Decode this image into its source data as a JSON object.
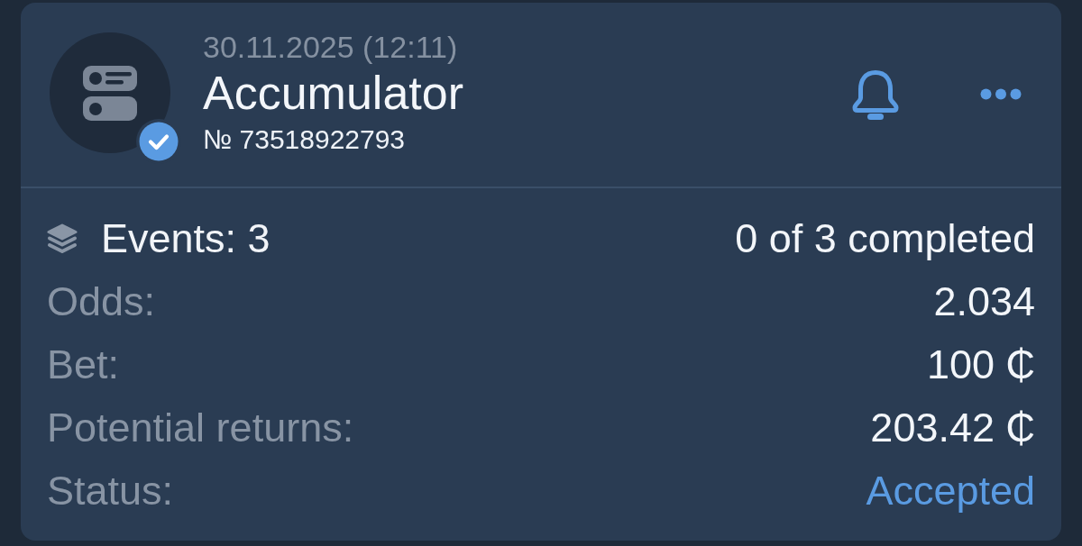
{
  "bet": {
    "date": "30.11.2025 (12:11)",
    "title": "Accumulator",
    "number": "№ 73518922793",
    "verified": true
  },
  "events": {
    "label": "Events: 3",
    "completed": "0 of 3 completed"
  },
  "details": [
    {
      "label": "Odds:",
      "value": "2.034",
      "kind": "plain"
    },
    {
      "label": "Bet:",
      "value": "100 ₵",
      "kind": "plain"
    },
    {
      "label": "Potential returns:",
      "value": "203.42 ₵",
      "kind": "plain"
    },
    {
      "label": "Status:",
      "value": "Accepted",
      "kind": "status"
    }
  ]
}
